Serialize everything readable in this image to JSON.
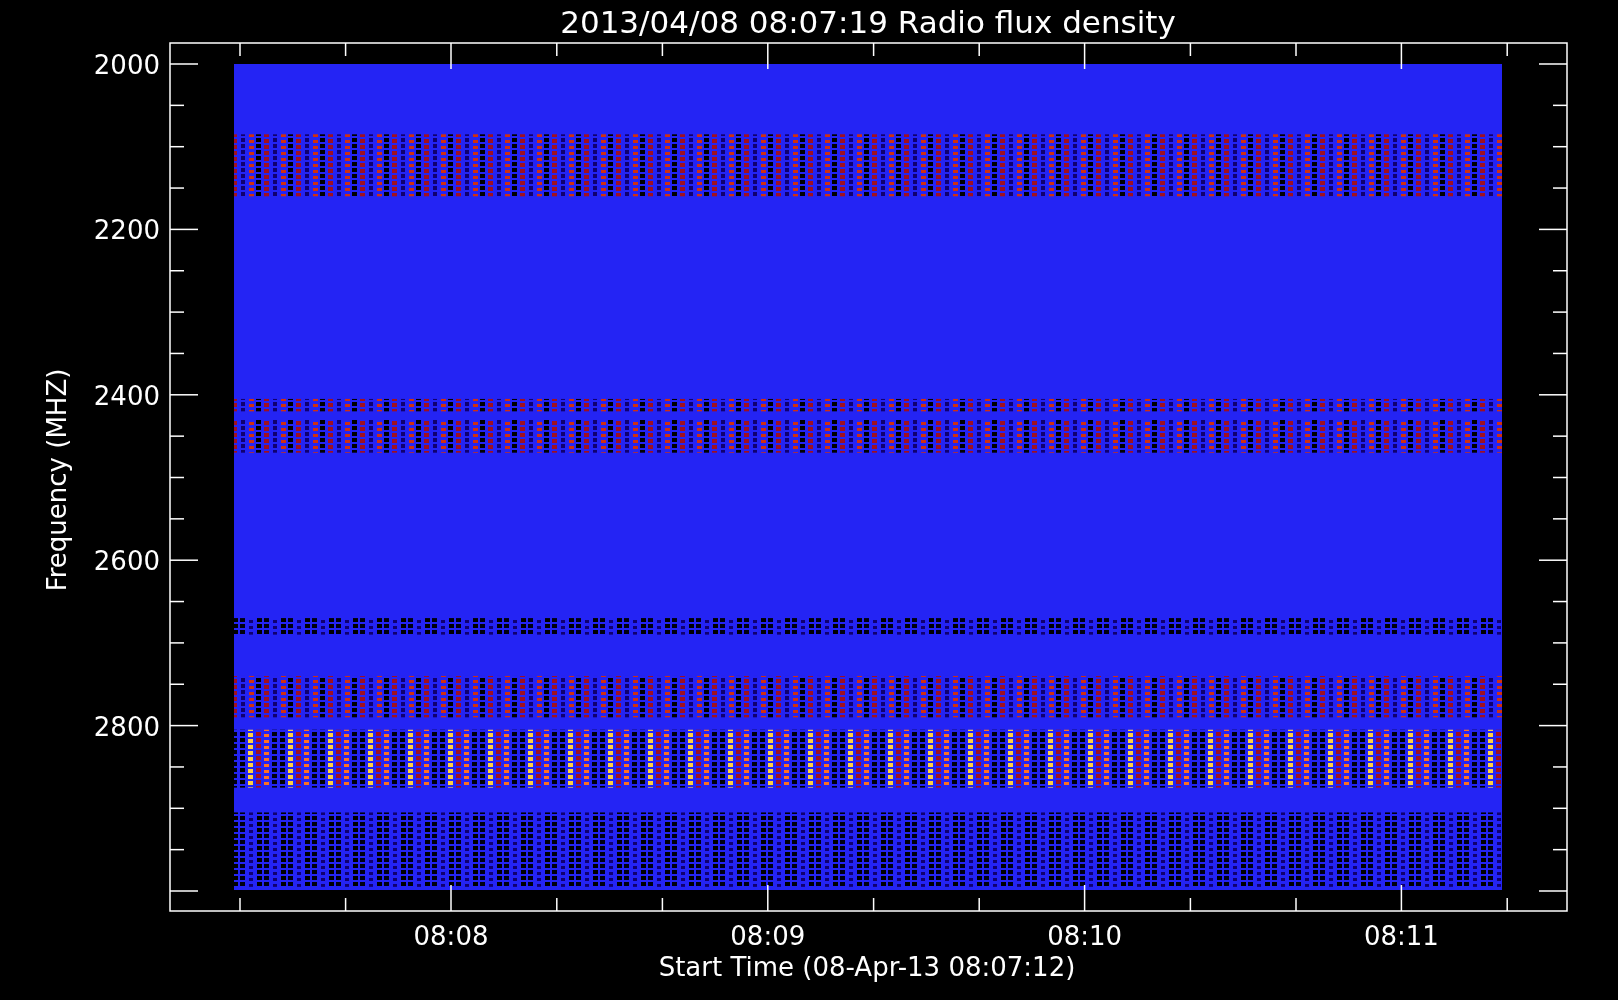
{
  "title": "2013/04/08 08:07:19 Radio flux density",
  "y_axis": {
    "label": "Frequency (MHZ)",
    "ticks": [
      "2000",
      "2200",
      "2400",
      "2600",
      "2800"
    ]
  },
  "x_axis": {
    "label": "Start Time (08-Apr-13 08:07:12)",
    "ticks": [
      "08:08",
      "08:09",
      "08:10",
      "08:11"
    ]
  }
}
